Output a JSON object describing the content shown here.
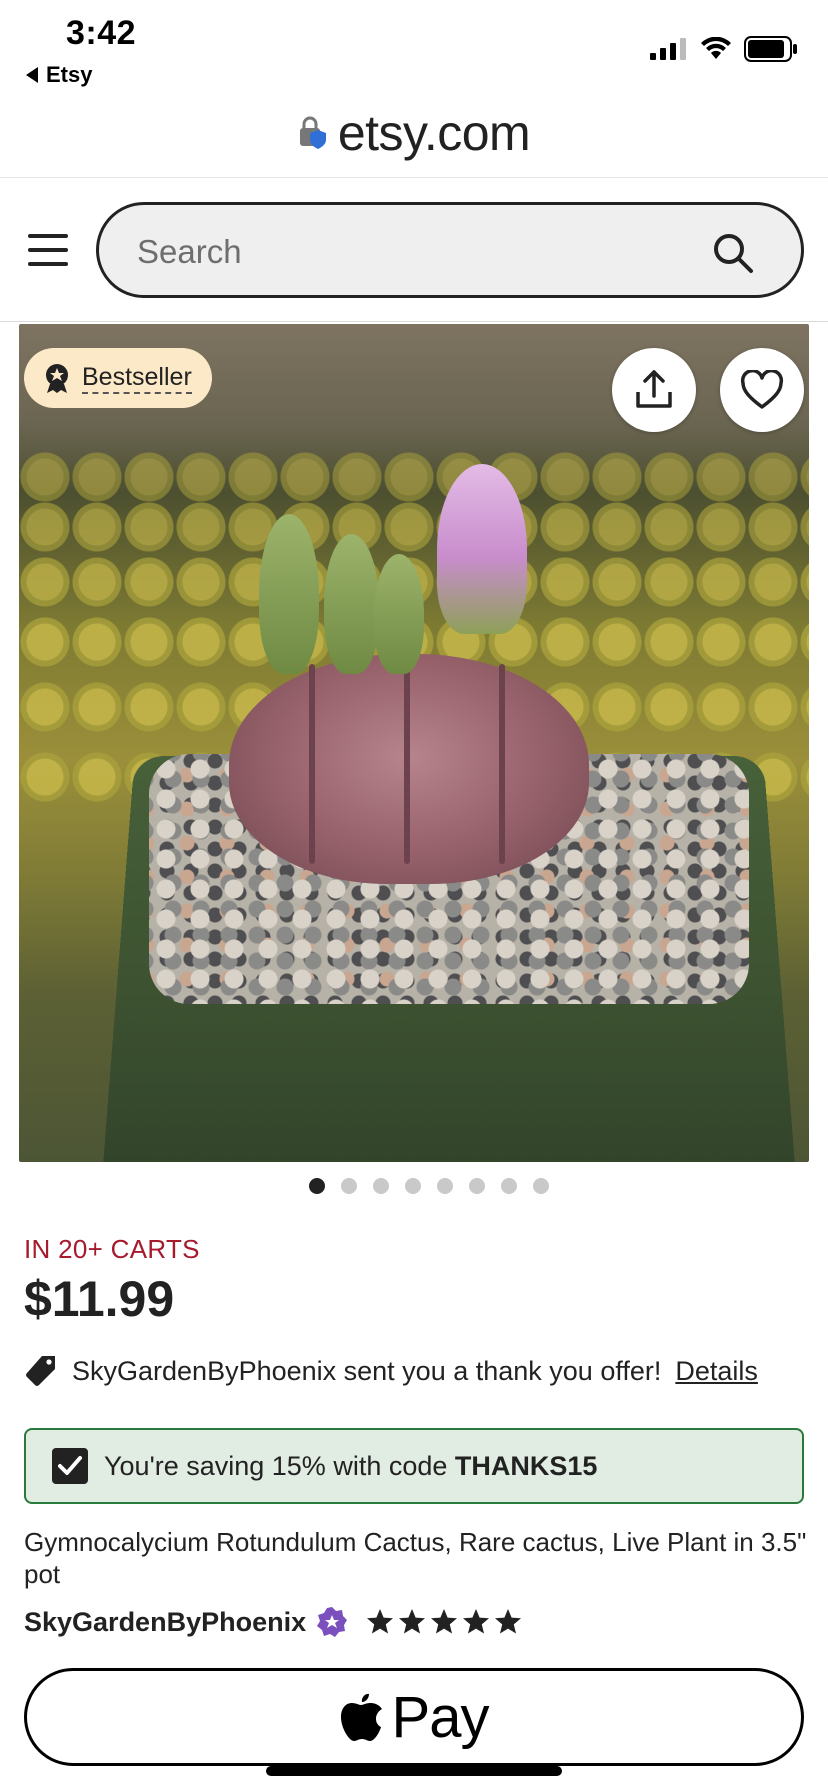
{
  "status_bar": {
    "time": "3:42",
    "back_app": "Etsy"
  },
  "url_bar": {
    "domain": "etsy.com"
  },
  "header": {
    "search_placeholder": "Search"
  },
  "product": {
    "badge": "Bestseller",
    "image_count": 8,
    "active_image": 1,
    "cart_status": "IN 20+ CARTS",
    "price": "$11.99",
    "offer_text": "SkyGardenByPhoenix sent you a thank you offer!",
    "offer_link": "Details",
    "coupon_prefix": "You're saving 15% with code ",
    "coupon_code": "THANKS15",
    "title": "Gymnocalycium Rotundulum Cactus, Rare cactus, Live Plant in 3.5\" pot",
    "shop_name": "SkyGardenByPhoenix",
    "rating_stars": 5
  },
  "checkout": {
    "apple_pay_label": "Pay"
  },
  "colors": {
    "cart_status": "#a61a2e",
    "coupon_bg": "#e1ece2",
    "coupon_border": "#2a7a3d",
    "badge_bg": "#fbe9c8",
    "star_seller": "#7b4fbd"
  }
}
